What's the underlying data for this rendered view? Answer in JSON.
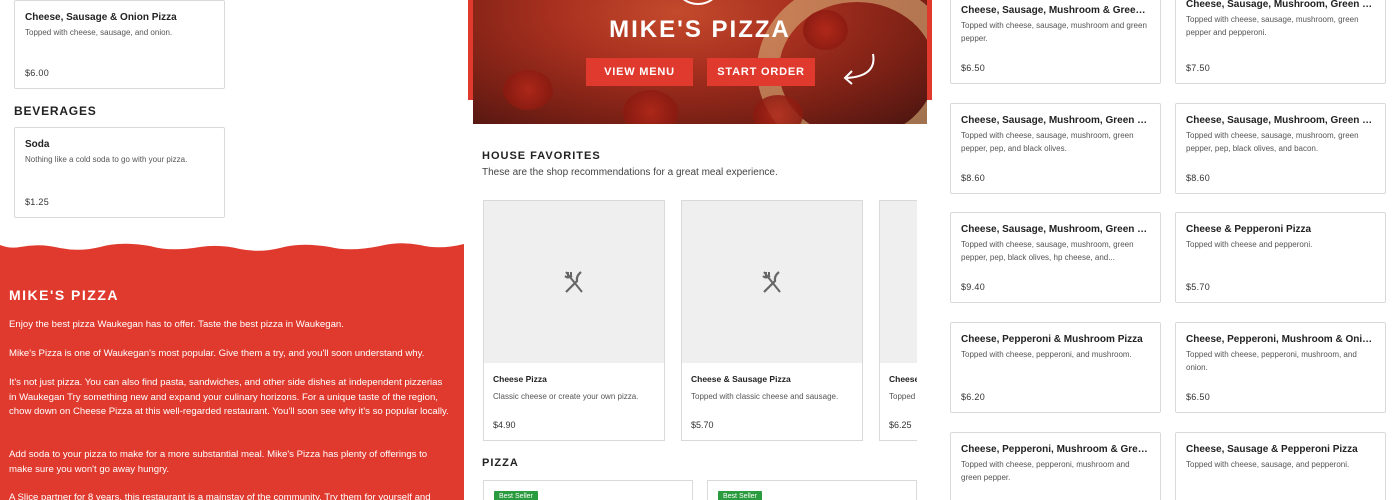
{
  "left_menu": {
    "top_item": {
      "name": "Cheese, Sausage & Onion Pizza",
      "desc": "Topped with cheese, sausage, and onion.",
      "price": "$6.00"
    },
    "beverages_heading": "BEVERAGES",
    "beverage": {
      "name": "Soda",
      "desc": "Nothing like a cold soda to go with your pizza.",
      "price": "$1.25"
    }
  },
  "about": {
    "title": "MIKE'S PIZZA",
    "paragraphs": [
      "Enjoy the best pizza Waukegan has to offer. Taste the best pizza in Waukegan.",
      "Mike's Pizza is one of Waukegan's most popular. Give them a try, and you'll soon understand why.",
      "It's not just pizza. You can also find pasta, sandwiches, and other side dishes at independent pizzerias in Waukegan Try something new and expand your culinary horizons. For a unique taste of the region, chow down on Cheese Pizza at this well-regarded restaurant. You'll soon see why it's so popular locally.",
      "Add soda to your pizza to make for a more substantial meal. Mike's Pizza has plenty of offerings to make sure you won't go away hungry.",
      "A Slice partner for 8 years, this restaurant is a mainstay of the community. Try them for yourself and"
    ]
  },
  "hero": {
    "title": "MIKE'S PIZZA",
    "view_menu": "VIEW MENU",
    "start_order": "START ORDER"
  },
  "favorites": {
    "heading": "HOUSE FAVORITES",
    "subheading": "These are the shop recommendations for a great meal experience.",
    "items": [
      {
        "name": "Cheese Pizza",
        "desc": "Classic cheese or create your own pizza.",
        "price": "$4.90"
      },
      {
        "name": "Cheese & Sausage Pizza",
        "desc": "Topped with classic cheese and sausage.",
        "price": "$5.70"
      },
      {
        "name": "Cheese",
        "desc": "Topped mushro",
        "price": "$6.25"
      }
    ]
  },
  "pizza_section": {
    "heading": "PIZZA",
    "badges": [
      "Best Seller",
      "Best Seller"
    ]
  },
  "right_menu": {
    "items": [
      {
        "name": "Cheese, Sausage, Mushroom & Green Pepper Pizza",
        "desc": "Topped with cheese, sausage, mushroom and green pepper.",
        "price": "$6.50"
      },
      {
        "name": "Cheese, Sausage, Mushroom, Green Pepper & Pep Pizza",
        "desc": "Topped with cheese, sausage, mushroom, green pepper and pepperoni.",
        "price": "$7.50"
      },
      {
        "name": "Cheese, Sausage, Mushroom, Green Pepper, Pep & Black Olive Pizza",
        "desc": "Topped with cheese, sausage, mushroom, green pepper, pep, and black olives.",
        "price": "$8.60"
      },
      {
        "name": "Cheese, Sausage, Mushroom, Green Pepper, Pep, Black Olive & Bacon Pizza",
        "desc": "Topped with cheese, sausage, mushroom, green pepper, pep, black olives, and bacon.",
        "price": "$8.60"
      },
      {
        "name": "Cheese, Sausage, Mushroom, Green Pepper, Pep, Black Olive & HP Cheese Pizza",
        "desc": "Topped with cheese, sausage, mushroom, green pepper, pep, black olives, hp cheese, and...",
        "price": "$9.40"
      },
      {
        "name": "Cheese & Pepperoni Pizza",
        "desc": "Topped with cheese and pepperoni.",
        "price": "$5.70"
      },
      {
        "name": "Cheese, Pepperoni & Mushroom Pizza",
        "desc": "Topped with cheese, pepperoni, and mushroom.",
        "price": "$6.20"
      },
      {
        "name": "Cheese, Pepperoni, Mushroom & Onion Pizza",
        "desc": "Topped with cheese, pepperoni, mushroom, and onion.",
        "price": "$6.50"
      },
      {
        "name": "Cheese, Pepperoni, Mushroom & Green Pepper Pizza",
        "desc": "Topped with cheese, pepperoni, mushroom and green pepper.",
        "price": ""
      },
      {
        "name": "Cheese, Sausage & Pepperoni Pizza",
        "desc": "Topped with cheese, sausage, and pepperoni.",
        "price": ""
      }
    ]
  },
  "icons": {
    "placeholder": "fork-knife-icon",
    "hero_arrow": "curved-arrow-icon"
  },
  "colors": {
    "brand_red": "#e03a2f",
    "badge_green": "#2b9b3f",
    "border": "#d9d9d9"
  }
}
